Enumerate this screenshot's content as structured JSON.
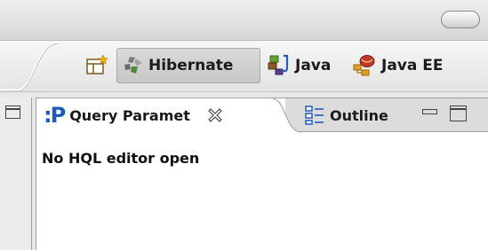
{
  "window": {
    "titlebar_control": "toolbar-toggle-pill"
  },
  "perspective_bar": {
    "open_perspective_icon": "open-perspective-icon",
    "perspectives": [
      {
        "label": "Hibernate",
        "icon": "hibernate-icon",
        "active": true
      },
      {
        "label": "Java",
        "icon": "java-icon",
        "active": false
      },
      {
        "label": "Java EE",
        "icon": "java-ee-icon",
        "active": false
      }
    ]
  },
  "view": {
    "tabs": [
      {
        "label": "Query Paramet",
        "icon": "query-parameters-icon",
        "icon_glyph": ":P",
        "active": true,
        "close_icon": "close-icon"
      },
      {
        "label": "Outline",
        "icon": "outline-icon",
        "active": false
      }
    ],
    "message": "No HQL editor open"
  },
  "colors": {
    "accent_blue": "#1e5bbd",
    "tab_active_bg": "#ffffff",
    "tab_inactive_bg": "#dcdcdc"
  }
}
